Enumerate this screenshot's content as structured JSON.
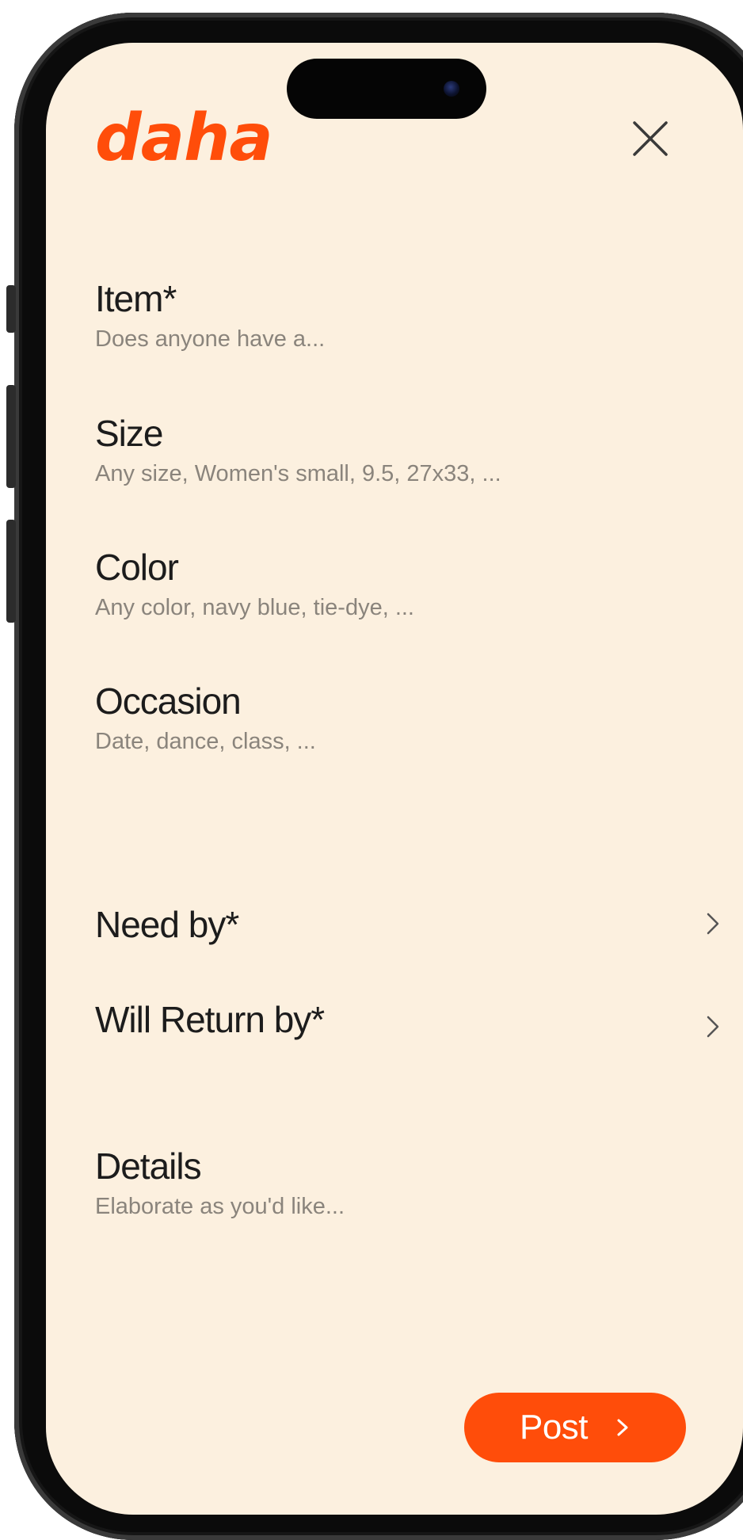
{
  "app": {
    "logo_text": "daha",
    "brand_color": "#ff4d0a",
    "background_color": "#fcf0df"
  },
  "header": {
    "close_icon": "close-icon"
  },
  "form": {
    "fields": [
      {
        "label": "Item*",
        "placeholder": "Does anyone have a..."
      },
      {
        "label": "Size",
        "placeholder": "Any size, Women's small, 9.5, 27x33, ..."
      },
      {
        "label": "Color",
        "placeholder": "Any color, navy blue, tie-dye, ..."
      },
      {
        "label": "Occasion",
        "placeholder": "Date, dance, class, ..."
      }
    ],
    "date_rows": [
      {
        "label": "Need by*",
        "icon": "chevron-right-icon"
      },
      {
        "label": "Will Return by*",
        "icon": "chevron-right-icon"
      }
    ],
    "details": {
      "label": "Details",
      "placeholder": "Elaborate as you'd like..."
    }
  },
  "footer": {
    "post_label": "Post",
    "post_icon": "chevron-right-icon"
  }
}
